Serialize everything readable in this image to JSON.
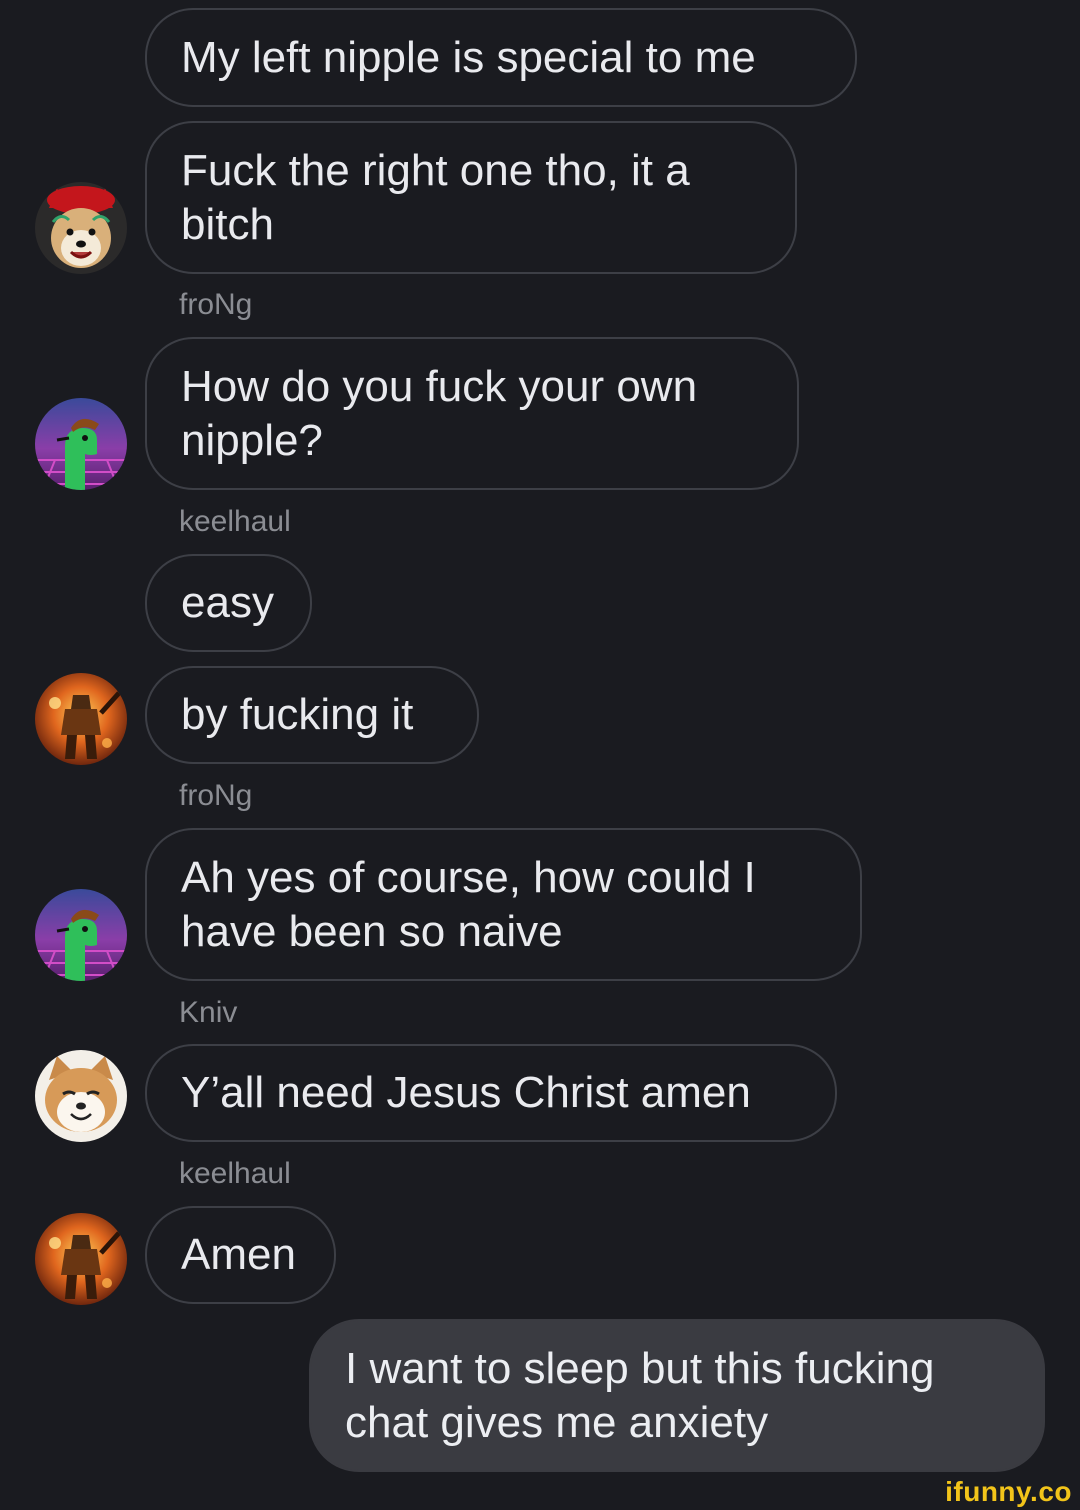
{
  "messages": [
    {
      "text": "My left nipple is special to me"
    },
    {
      "text": "Fuck the right one tho, it a bitch"
    },
    {
      "text": "How do you fuck your own nipple?"
    },
    {
      "text": "easy"
    },
    {
      "text": "by fucking it"
    },
    {
      "text": "Ah yes of course, how could I have been so naive"
    },
    {
      "text": "Y’all need Jesus Christ amen"
    },
    {
      "text": "Amen"
    },
    {
      "text": "I want to sleep but this fucking chat gives me anxiety"
    }
  ],
  "senders": [
    "froNg",
    "keelhaul",
    "froNg",
    "Kniv",
    "keelhaul"
  ],
  "avatars": [
    "shiba-devil-avatar",
    "green-dino-avatar",
    "fiery-knight-avatar",
    "green-dino-avatar",
    "smiling-shiba-avatar",
    "fiery-knight-avatar"
  ],
  "watermark": "ifunny.co",
  "colors": {
    "background": "#1a1b20",
    "bubble_border": "#3d3f46",
    "own_bubble": "#3a3b41",
    "sender_text": "#8b8d93",
    "watermark": "#f2c41a"
  }
}
